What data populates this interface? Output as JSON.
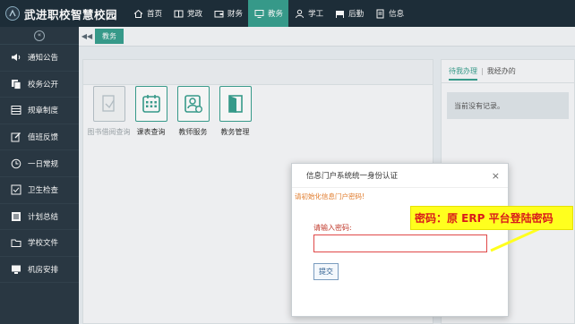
{
  "app": {
    "title": "武进职校智慧校园"
  },
  "nav": {
    "items": [
      {
        "label": "首页",
        "icon": "home-icon"
      },
      {
        "label": "党政",
        "icon": "book-icon"
      },
      {
        "label": "财务",
        "icon": "wallet-icon"
      },
      {
        "label": "教务",
        "icon": "monitor-icon",
        "active": true
      },
      {
        "label": "学工",
        "icon": "user-icon"
      },
      {
        "label": "后勤",
        "icon": "flag-icon"
      },
      {
        "label": "信息",
        "icon": "doc-icon"
      }
    ]
  },
  "sidebar": {
    "collapse_icon": "double-chevron-left-icon",
    "items": [
      {
        "label": "通知公告",
        "icon": "speaker-icon"
      },
      {
        "label": "校务公开",
        "icon": "files-icon"
      },
      {
        "label": "规章制度",
        "icon": "grid-icon"
      },
      {
        "label": "值班反馈",
        "icon": "edit-icon"
      },
      {
        "label": "一日常规",
        "icon": "clock-icon"
      },
      {
        "label": "卫生检查",
        "icon": "check-icon"
      },
      {
        "label": "计划总结",
        "icon": "list-icon"
      },
      {
        "label": "学校文件",
        "icon": "folder-icon"
      },
      {
        "label": "机房安排",
        "icon": "desktop-icon"
      }
    ]
  },
  "tabstrip": {
    "active_tab": "教务"
  },
  "apps": [
    {
      "label": "图书借阅查询",
      "icon": "book-query-icon",
      "disabled": true
    },
    {
      "label": "课表查询",
      "icon": "calendar-icon"
    },
    {
      "label": "教师服务",
      "icon": "teacher-icon"
    },
    {
      "label": "教务管理",
      "icon": "door-icon"
    }
  ],
  "right_panel": {
    "tab_active": "待我办理",
    "tab_other": "我经办的",
    "empty_text": "当前没有记录。"
  },
  "modal": {
    "title": "信息门户系统统一身份认证",
    "warning": "请初始化信息门户密码!",
    "password_label": "请输入密码:",
    "password_value": "",
    "submit_label": "提交"
  },
  "annotation": {
    "text": "密码：原 ERP 平台登陆密码"
  },
  "colors": {
    "accent": "#39a08f",
    "topbar": "#1f2f3b",
    "sidebar": "#2b3a45",
    "callout_bg": "#ffff1e",
    "callout_text": "#d91a1a"
  }
}
